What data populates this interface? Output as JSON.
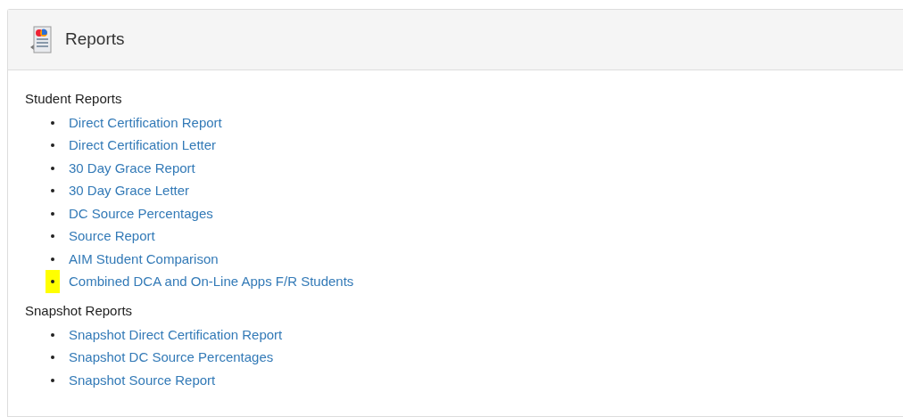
{
  "panel": {
    "title": "Reports"
  },
  "sections": [
    {
      "heading": "Student Reports",
      "items": [
        {
          "label": "Direct Certification Report",
          "highlighted": false
        },
        {
          "label": "Direct Certification Letter",
          "highlighted": false
        },
        {
          "label": "30 Day Grace Report",
          "highlighted": false
        },
        {
          "label": "30 Day Grace Letter",
          "highlighted": false
        },
        {
          "label": "DC Source Percentages",
          "highlighted": false
        },
        {
          "label": "Source Report",
          "highlighted": false
        },
        {
          "label": "AIM Student Comparison",
          "highlighted": false
        },
        {
          "label": "Combined DCA and On-Line Apps F/R Students",
          "highlighted": true
        }
      ]
    },
    {
      "heading": "Snapshot Reports",
      "items": [
        {
          "label": "Snapshot Direct Certification Report",
          "highlighted": false
        },
        {
          "label": "Snapshot DC Source Percentages",
          "highlighted": false
        },
        {
          "label": "Snapshot Source Report",
          "highlighted": false
        }
      ]
    }
  ]
}
